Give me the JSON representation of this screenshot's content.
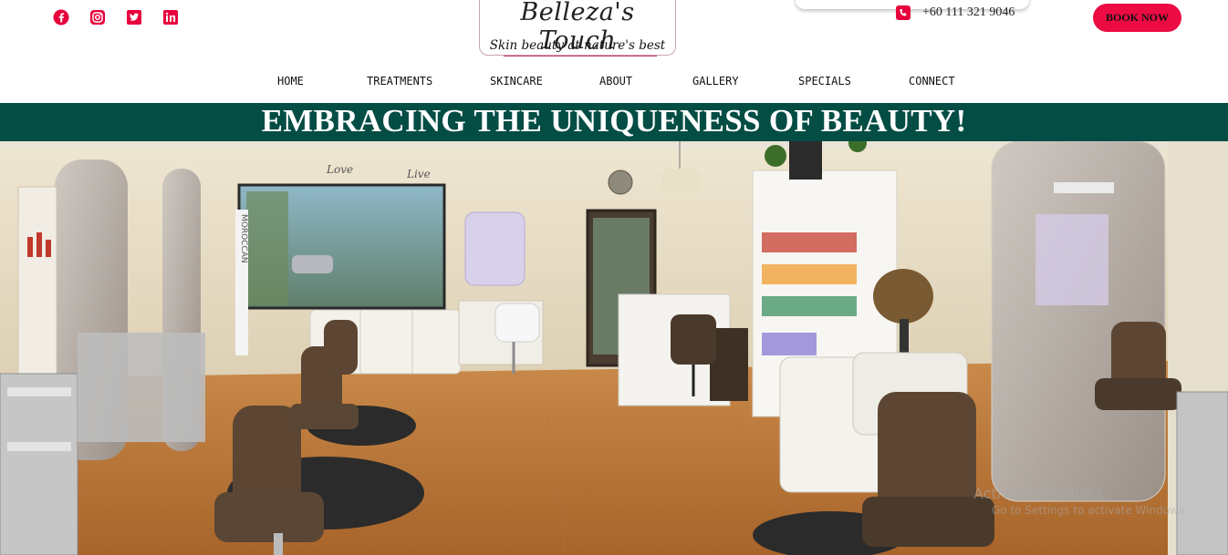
{
  "social": {
    "icons": [
      "facebook-icon",
      "instagram-icon",
      "twitter-icon",
      "linkedin-icon"
    ],
    "color": "#e8003d"
  },
  "logo": {
    "title": "Belleza's Touch",
    "tagline": "Skin beauty at nature's best"
  },
  "contact": {
    "phone": "+60 111 321 9046",
    "phone_icon": "phone-icon"
  },
  "cta": {
    "book_label": "BOOK NOW",
    "color": "#ec0b43"
  },
  "nav": {
    "items": [
      {
        "label": "HOME"
      },
      {
        "label": "TREATMENTS"
      },
      {
        "label": "SKINCARE"
      },
      {
        "label": "ABOUT"
      },
      {
        "label": "GALLERY"
      },
      {
        "label": "SPECIALS"
      },
      {
        "label": "CONNECT"
      }
    ]
  },
  "banner": {
    "headline": "EMBRACING THE UNIQUENESS OF BEAUTY!",
    "background": "#044d45"
  },
  "hero": {
    "wall_text_1": "Love",
    "wall_text_2": "Live",
    "window_sign": "MOROCCAN"
  },
  "watermark": {
    "title": "Activate Windows",
    "subtitle": "Go to Settings to activate Windows."
  }
}
